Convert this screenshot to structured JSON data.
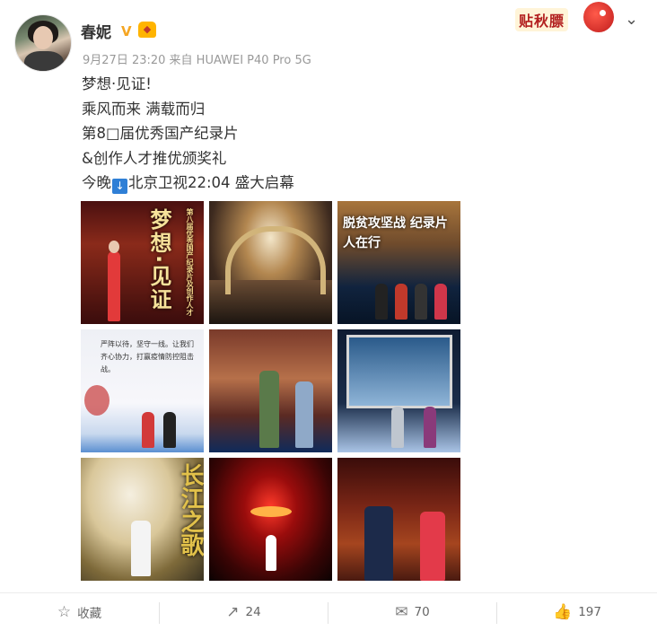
{
  "post": {
    "username": "春妮",
    "verified_mark": "V",
    "badge_icon": "gold-medal-badge-icon",
    "meta": "9月27日 23:20 来自 HUAWEI P40 Pro 5G",
    "lines": [
      "梦想·见证!",
      "乘风而来 满载而归",
      "第8□届优秀国产纪录片",
      "&创作人才推优颁奖礼"
    ],
    "last_line": {
      "prefix": "今晚",
      "emoji": "↓",
      "suffix": "北京卫视22:04 盛大启幕"
    }
  },
  "sticker": {
    "text": "贴秋膘",
    "icon": "red-bird-mascot-icon"
  },
  "menu": {
    "icon": "chevron-down-icon",
    "glyph": "⌄"
  },
  "images": {
    "i1_caption": "梦想·见证",
    "i1_side_caption": "第八届优秀国产纪录片及创作人才",
    "i3_caption": "脱贫攻坚战 纪录片人在行",
    "i4_caption": "严阵以待，坚守一线。让我们齐心协力，打赢疫情防控阻击战。",
    "i7_caption": "长江之歌"
  },
  "actions": {
    "favorite": {
      "icon": "star-outline-icon",
      "glyph": "☆",
      "label": "收藏"
    },
    "repost": {
      "icon": "share-icon",
      "glyph": "↗",
      "count": "24"
    },
    "comment": {
      "icon": "comment-icon",
      "glyph": "✉",
      "count": "70"
    },
    "like": {
      "icon": "thumbs-up-icon",
      "glyph": "👍",
      "count": "197"
    }
  },
  "colors": {
    "verified": "#f5a623",
    "link_box": "#2f7fd6",
    "meta_text": "#999999"
  }
}
